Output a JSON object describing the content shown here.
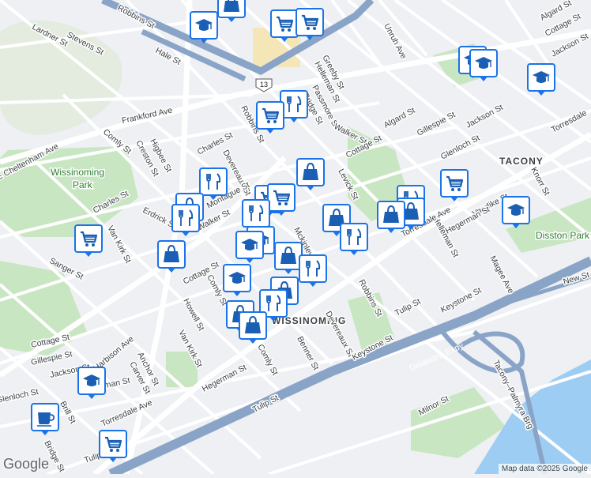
{
  "map": {
    "labels": {
      "robbins_st_top": "Robbins St",
      "lardner_st": "Lardner St",
      "stevens_st": "Stevens St",
      "hale_st": "Hale St",
      "unruh_ave": "Unruh Ave",
      "greeby_st": "Greeby St",
      "helleman_st": "Helleman St",
      "passmore_st": "Passmore St",
      "bridge_st": "Bridge St",
      "algard_st_top": "Algard St",
      "cottage_st_top": "Cottage St",
      "jackson_st_top": "Jackson St",
      "frankford_ave": "Frankford Ave",
      "robbins_st_mid": "Robbins St",
      "walker_st_top": "Walker St",
      "algard_st_mid": "Algard St",
      "gillespie_st": "Gillespie St",
      "jackson_st_mid": "Jackson St",
      "glenloch_st": "Glenloch St",
      "torresdale_right": "Torresdale",
      "tacony": "TACONY",
      "comly_st": "Comly St",
      "higbee_st": "Higbee St",
      "creston_st": "Creston St",
      "charles_st": "Charles St",
      "devereaux_st": "Devereaux St",
      "cottage_st_mid": "Cottage St",
      "levick_st": "Levick St",
      "knorr_st": "Knorr St",
      "wissinoming_park": "Wissinoming Park",
      "cheltenham_ave": "E Cheltenham Ave",
      "montague_st": "Montague St",
      "walker_st": "Walker St",
      "erdrick_st": "Erdrick St",
      "charles_st_left": "Charles St",
      "van_kirk_st": "Van Kirk St",
      "mckinley_st": "Mckinley St",
      "vandike_st": "Vandike St",
      "hegerman_st_right": "Hegerman St",
      "helleman_st_right": "Helleman St",
      "torresdale_ave_right": "Torresdale Ave",
      "disston_park": "Disston Park",
      "sanger_st": "Sanger St",
      "cottage_st_low": "Cottage St",
      "comly_st_low": "Comly St",
      "howell_st": "Howell St",
      "van_kirk_st_low": "Van Kirk St",
      "robbins_st_low": "Robbins St",
      "keystone_st_right": "Keystone St",
      "tulip_st_right": "Tulip St",
      "magee_ave": "Magee Ave",
      "new_st": "New St",
      "wissinoming": "WISSINOMING",
      "devereaux_st_low": "Devereaux St",
      "benner_st": "Benner St",
      "keystone_st_low": "Keystone St",
      "delaware_expy": "Delaware Expy",
      "cottage_st_bottom": "Cottage St",
      "gillespie_st_bottom": "Gillespie St",
      "jackson_st_bottom": "Jackson St",
      "harbison_ave": "Harbison Ave",
      "anchor_st": "Anchor St",
      "carver_st": "Carver St",
      "ditman_st": "Ditman St",
      "glenloch_st_bottom": "Glenloch St",
      "brill_st": "Brill St",
      "torresdale_ave_bottom": "Torresdale Ave",
      "hegerman_st_low": "Hegerman St",
      "comly_st_bottom": "Comly St",
      "tulip_st_bottom": "Tulip St",
      "milnor_st": "Milnor St",
      "tacony_palmyra_brg": "Tacony–Palmyra Brg",
      "tulip_left": "Tulip",
      "bridge_st_bottom": "Bridge St",
      "route_13": "13"
    },
    "poi_icons": {
      "shopping_cart": "shopping-cart-icon",
      "restaurant": "restaurant-icon",
      "shopping_bag": "shopping-bag-icon",
      "school": "school-icon",
      "cafe": "cafe-icon"
    },
    "colors": {
      "background": "#eef0f3",
      "road": "#ffffff",
      "highway": "#8aa4c8",
      "park": "#c9e6c2",
      "water": "#9ecdf4",
      "pin_border": "#1a73e8",
      "pin_icon": "#1a5fb4"
    }
  },
  "attribution": "Map data ©2025 Google",
  "logo": "Google"
}
